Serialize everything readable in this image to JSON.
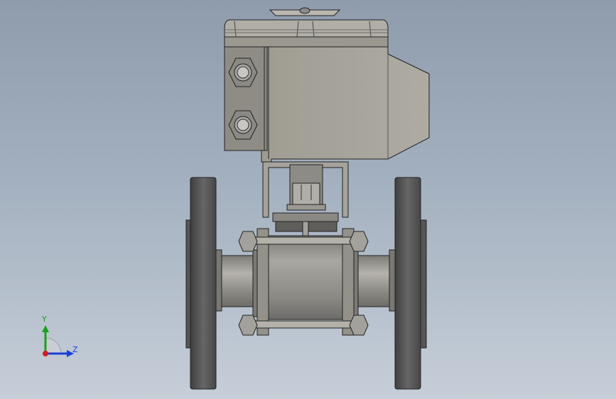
{
  "axes": {
    "y_label": "Y",
    "z_label": "Z",
    "y_color": "#1aa01a",
    "z_color": "#1a3fd8",
    "x_color": "#d81a1a"
  },
  "colors": {
    "actuator_body": "#a8a59d",
    "actuator_dark": "#8f8c85",
    "flange": "#5a5a5a",
    "valve_body": "#8e8d88",
    "pipe": "#999790",
    "outline": "#1c1c1c"
  }
}
